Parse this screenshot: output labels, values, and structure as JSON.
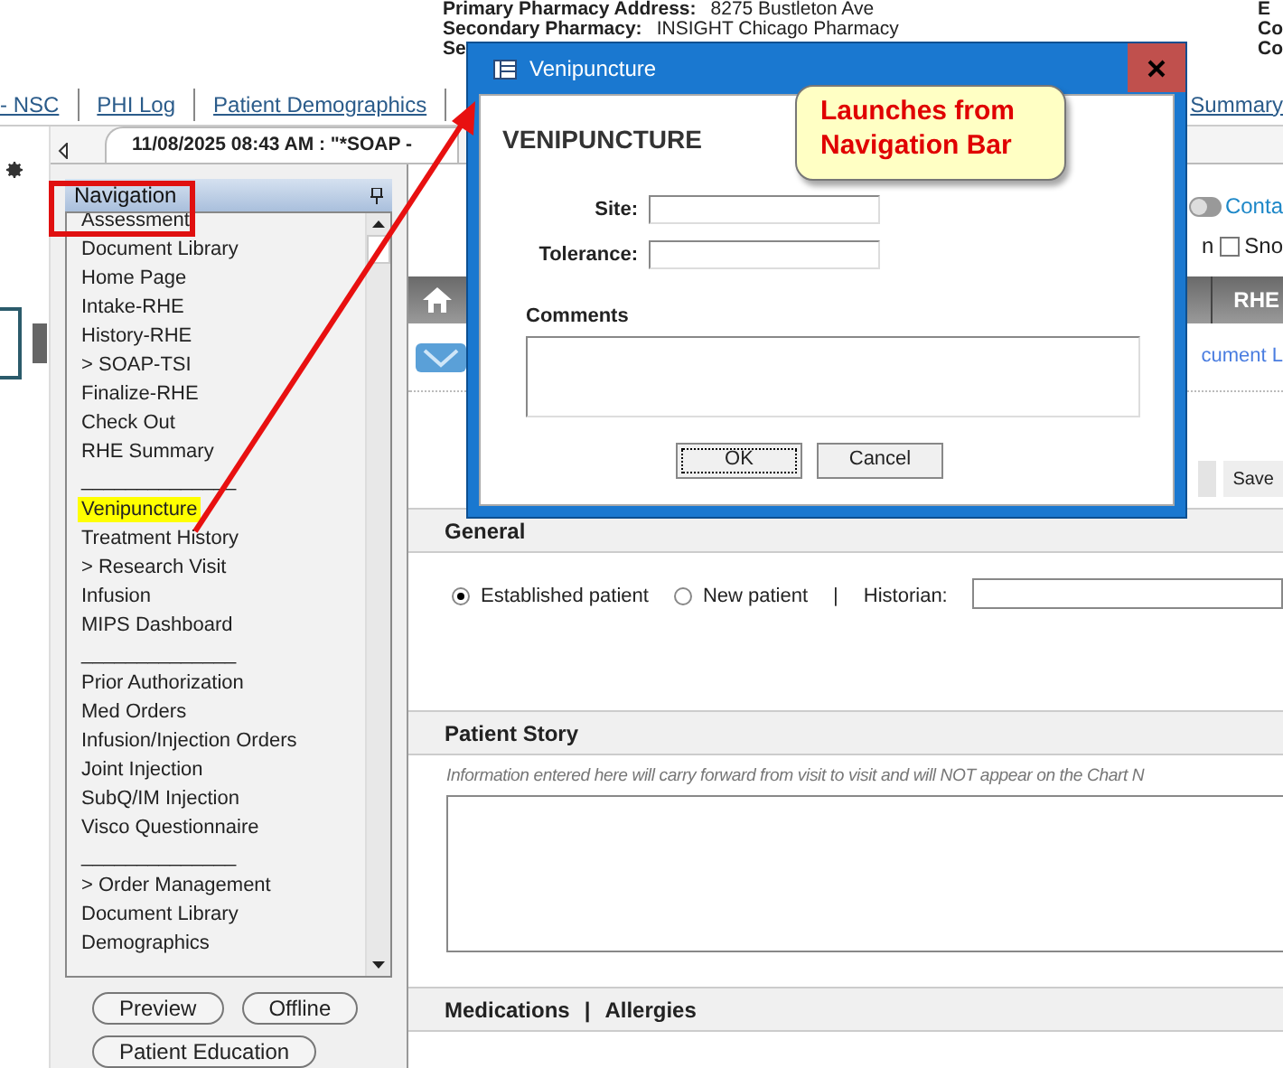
{
  "header": {
    "fields": [
      {
        "label": "Primary Pharmacy Address:",
        "value": "8275 Bustleton Ave"
      },
      {
        "label": "Secondary Pharmacy:",
        "value": "INSIGHT Chicago Pharmacy"
      },
      {
        "label": "Se"
      }
    ],
    "right_labels": [
      "E",
      "Co",
      "Co"
    ]
  },
  "links": [
    "- NSC",
    "PHI Log",
    "Patient Demographics",
    "Summary"
  ],
  "encounter_tab": "11/08/2025 08:43 AM : \"*SOAP -",
  "navigation": {
    "title": "Navigation",
    "items": [
      {
        "label": "Assessment",
        "highlighted": false
      },
      {
        "label": "Document Library",
        "highlighted": false
      },
      {
        "label": "Home Page",
        "highlighted": false
      },
      {
        "label": "Intake-RHE",
        "highlighted": false
      },
      {
        "label": "History-RHE",
        "highlighted": false
      },
      {
        "label": "> SOAP-TSI",
        "highlighted": false
      },
      {
        "label": "Finalize-RHE",
        "highlighted": false
      },
      {
        "label": "Check Out",
        "highlighted": false
      },
      {
        "label": "RHE Summary",
        "highlighted": false
      },
      {
        "label": "______________",
        "highlighted": false
      },
      {
        "label": "Venipuncture",
        "highlighted": true
      },
      {
        "label": "Treatment History",
        "highlighted": false
      },
      {
        "label": "> Research Visit",
        "highlighted": false
      },
      {
        "label": "Infusion",
        "highlighted": false
      },
      {
        "label": "MIPS Dashboard",
        "highlighted": false
      },
      {
        "label": "______________",
        "highlighted": false
      },
      {
        "label": "Prior Authorization",
        "highlighted": false
      },
      {
        "label": "Med Orders",
        "highlighted": false
      },
      {
        "label": "Infusion/Injection Orders",
        "highlighted": false
      },
      {
        "label": "Joint Injection",
        "highlighted": false
      },
      {
        "label": "SubQ/IM Injection",
        "highlighted": false
      },
      {
        "label": "Visco Questionnaire",
        "highlighted": false
      },
      {
        "label": "______________",
        "highlighted": false
      },
      {
        "label": "> Order Management",
        "highlighted": false
      },
      {
        "label": "Document Library",
        "highlighted": false
      },
      {
        "label": "Demographics",
        "highlighted": false
      }
    ]
  },
  "nav_buttons": [
    "Preview",
    "Offline",
    "Patient Education"
  ],
  "main": {
    "toggle": {
      "on": false
    },
    "contacts_link": "Conta",
    "checkbox": {
      "label_before": "n",
      "label": "Sno",
      "checked": false
    },
    "toolbar_tab": "RHE",
    "doc_link": "cument L",
    "save": "Save",
    "general": {
      "title": "General",
      "radios": [
        {
          "label": "Established patient",
          "selected": true
        },
        {
          "label": "New patient",
          "selected": false
        }
      ],
      "separator": "|",
      "historian_label": "Historian:"
    },
    "patient_story": {
      "title": "Patient Story",
      "note": "Information entered here will carry forward from visit to visit and will NOT appear on the Chart N"
    },
    "meds_header": {
      "left": "Medications",
      "separator": "|",
      "right": "Allergies"
    }
  },
  "dialog": {
    "title": "Venipuncture",
    "heading": "VENIPUNCTURE",
    "fields": [
      {
        "label": "Site:"
      },
      {
        "label": "Tolerance:"
      }
    ],
    "comments_label": "Comments",
    "buttons": [
      {
        "label": "OK",
        "focused": true
      },
      {
        "label": "Cancel",
        "focused": false
      }
    ]
  },
  "callout": "Launches from Navigation Bar"
}
